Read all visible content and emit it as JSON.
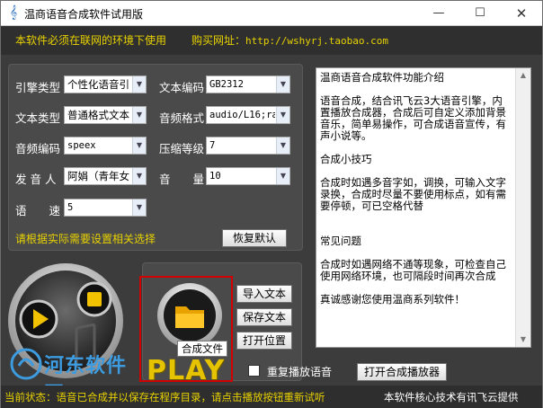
{
  "window": {
    "title": "温商语音合成软件试用版",
    "minimize_glyph": "—",
    "maximize_glyph": "☐",
    "close_glyph": "✕"
  },
  "topbar": {
    "notice": "本软件必须在联网的环境下使用",
    "buy_label": "购买网址：",
    "buy_url": "http://wshyrj.taobao.com"
  },
  "settings": {
    "engine_type": {
      "label": "引擎类型",
      "value": "个性化语音引"
    },
    "text_encoding": {
      "label": "文本编码",
      "value": "GB2312"
    },
    "text_type": {
      "label": "文本类型",
      "value": "普通格式文本"
    },
    "audio_format": {
      "label": "音频格式",
      "value": "audio/L16;ra"
    },
    "audio_encoding": {
      "label": "音频编码",
      "value": "speex"
    },
    "compression": {
      "label": "压缩等级",
      "value": "7"
    },
    "speaker": {
      "label": "发 音 人",
      "value": "阿娟（青年女"
    },
    "volume": {
      "label": "音　　量",
      "value": "10"
    },
    "speed": {
      "label": "语　　速",
      "value": "5"
    },
    "hint": "请根据实际需要设置相关选择",
    "reset_label": "恢复默认"
  },
  "intro": {
    "paragraphs": [
      "温商语音合成软件功能介绍",
      "",
      "语音合成，结合讯飞云3大语音引擎，内置播放合成器，合成后可自定义添加背景音乐，简单易操作，可合成语音宣传，有声小说等。",
      "",
      "合成小技巧",
      "",
      "合成时如遇多音字如，调换，可输入文字录换，合成时尽量不要使用标点，如有需要停顿，可已空格代替",
      "",
      "",
      "常见问题",
      "",
      "合成时如遇网络不通等现象，可检查自己使用网络环境，也可隔段时间再次合成",
      "",
      "真诚感谢您使用温商系列软件！"
    ]
  },
  "actions": {
    "import_text": "导入文本",
    "save_text": "保存文本",
    "open_location": "打开位置",
    "synthesize_tooltip": "合成文件",
    "play_text": "PLAY",
    "repeat_label": "重复播放语音",
    "open_player": "打开合成播放器"
  },
  "watermark": {
    "text": "河东软件园"
  },
  "status": {
    "left": "当前状态：语音已合成并以保存在程序目录，请点击播放按钮重新试听",
    "right": "本软件核心技术有讯飞云提供"
  },
  "colors": {
    "accent_yellow": "#e8d200",
    "highlight_red": "#d00000",
    "background": "#3c3c3c"
  }
}
